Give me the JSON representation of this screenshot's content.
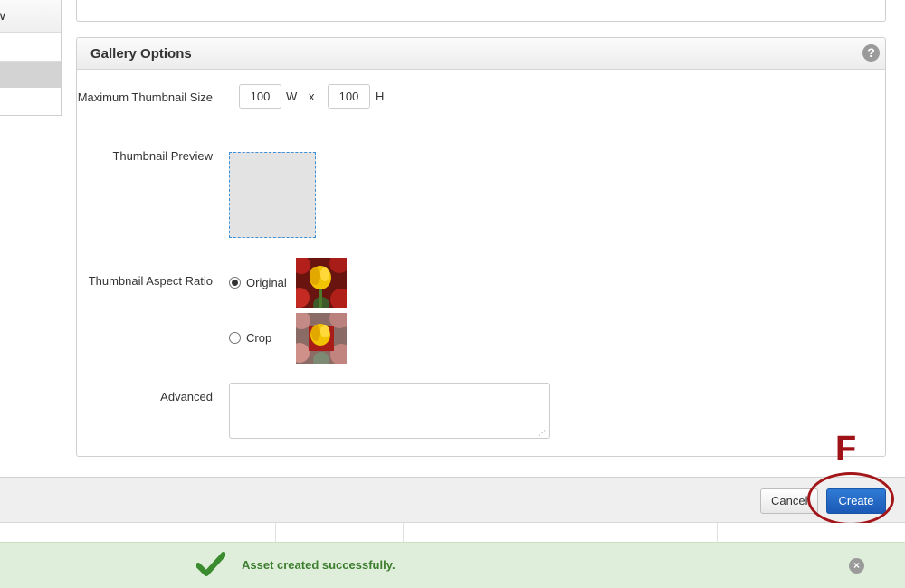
{
  "left_nav": {
    "chevron": "∨"
  },
  "gallery_panel": {
    "title": "Gallery Options",
    "help_icon": "?",
    "max_thumb": {
      "label": "Maximum Thumbnail Size",
      "width_value": "100",
      "width_unit": "W",
      "separator": "x",
      "height_value": "100",
      "height_unit": "H"
    },
    "preview": {
      "label": "Thumbnail Preview"
    },
    "aspect_ratio": {
      "label": "Thumbnail Aspect Ratio",
      "options": [
        {
          "label": "Original",
          "selected": true
        },
        {
          "label": "Crop",
          "selected": false
        }
      ]
    },
    "advanced": {
      "label": "Advanced",
      "value": ""
    }
  },
  "footer": {
    "cancel_label": "Cancel",
    "create_label": "Create"
  },
  "annotation": {
    "letter": "F",
    "color": "#a3161a"
  },
  "notification": {
    "message": "Asset created successfully.",
    "close_glyph": "×",
    "color": "#3d7d2f"
  }
}
